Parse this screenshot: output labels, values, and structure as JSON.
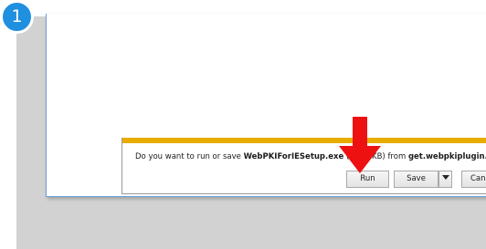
{
  "step": {
    "number": "1"
  },
  "download_bar": {
    "message_prefix": "Do you want to run or save ",
    "file_name": "WebPKIForIESetup.exe",
    "message_middle": " (3,9",
    "message_hidden": "… KB) fr",
    "message_suffix": "om ",
    "source_host": "get.webpkiplugin.com",
    "buttons": {
      "run_label": "Run",
      "save_label": "Save",
      "cancel_label": "Cancel"
    }
  },
  "colors": {
    "accent_bar": "#e9ac00",
    "step_badge": "#1f8fe0",
    "arrow": "#ee1111"
  },
  "icons": {
    "pointer": "red-down-arrow-icon",
    "save_dropdown": "chevron-down-icon"
  }
}
